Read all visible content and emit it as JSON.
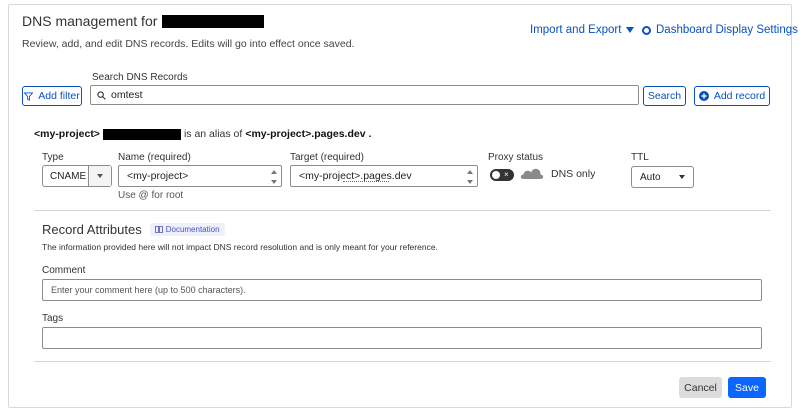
{
  "header": {
    "title": "DNS management for",
    "subtitle": "Review, add, and edit DNS records. Edits will go into effect once saved.",
    "import_export": "Import and Export",
    "dashboard_settings": "Dashboard Display Settings"
  },
  "search": {
    "label": "Search DNS Records",
    "add_filter": "Add filter",
    "value": "omtest",
    "search_button": "Search",
    "add_record": "Add record"
  },
  "record": {
    "alias_name": "<my-project>",
    "alias_mid": "is an alias of",
    "alias_target": "<my-project>.pages.dev",
    "type_label": "Type",
    "type_value": "CNAME",
    "name_label": "Name (required)",
    "name_value": "<my-project>",
    "name_hint": "Use @ for root",
    "target_label": "Target (required)",
    "target_value": "<my-project>.pages.dev",
    "proxy_label": "Proxy status",
    "proxy_value": "DNS only",
    "proxied": false,
    "ttl_label": "TTL",
    "ttl_value": "Auto"
  },
  "attributes": {
    "heading": "Record Attributes",
    "doc_badge": "Documentation",
    "description": "The information provided here will not impact DNS record resolution and is only meant for your reference.",
    "comment_label": "Comment",
    "comment_placeholder": "Enter your comment here (up to 500 characters).",
    "tags_label": "Tags"
  },
  "footer": {
    "cancel": "Cancel",
    "save": "Save"
  },
  "colors": {
    "accent": "#0a51c1",
    "save_bg": "#0a66ff"
  }
}
